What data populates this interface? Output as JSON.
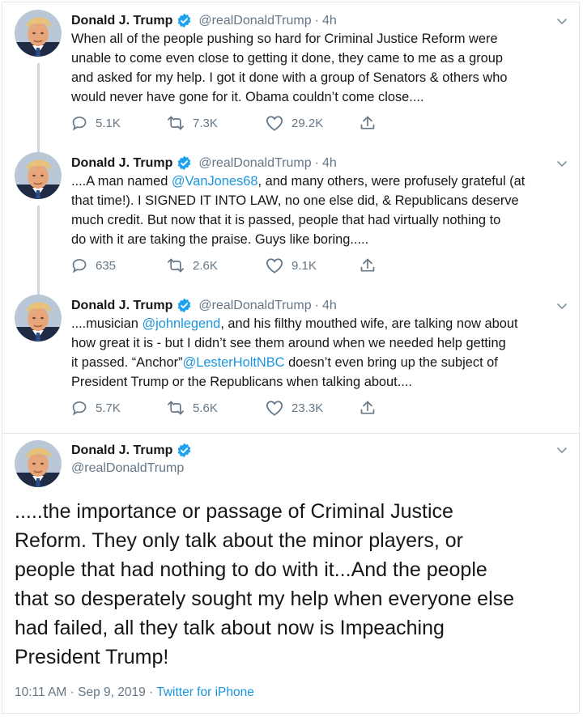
{
  "tweets": [
    {
      "name": "Donald J. Trump",
      "handle": "@realDonaldTrump",
      "time": "4h",
      "lines": [
        [
          {
            "t": "When all of the people pushing so hard for Criminal Justice Reform were"
          }
        ],
        [
          {
            "t": "unable to come even close to getting it done, they came to me as a group"
          }
        ],
        [
          {
            "t": "and asked for my help. I got it done with a group of Senators & others who"
          }
        ],
        [
          {
            "t": "would never have gone for it. Obama couldn’t come close...."
          }
        ]
      ],
      "replies": "5.1K",
      "retweets": "7.3K",
      "likes": "29.2K"
    },
    {
      "name": "Donald J. Trump",
      "handle": "@realDonaldTrump",
      "time": "4h",
      "lines": [
        [
          {
            "t": "....A man named "
          },
          {
            "t": "@VanJones68",
            "m": true
          },
          {
            "t": ", and many others, were profusely grateful (at"
          }
        ],
        [
          {
            "t": "that time!). I SIGNED IT INTO LAW, no one else did, & Republicans deserve"
          }
        ],
        [
          {
            "t": "much credit. But now that it is passed, people that had virtually nothing to"
          }
        ],
        [
          {
            "t": "do with it are taking the praise. Guys like boring....."
          }
        ]
      ],
      "replies": "635",
      "retweets": "2.6K",
      "likes": "9.1K"
    },
    {
      "name": "Donald J. Trump",
      "handle": "@realDonaldTrump",
      "time": "4h",
      "lines": [
        [
          {
            "t": "....musician "
          },
          {
            "t": "@johnlegend",
            "m": true
          },
          {
            "t": ", and his filthy mouthed wife, are talking now about"
          }
        ],
        [
          {
            "t": "how great it is - but I didn’t see them around when we needed help getting"
          }
        ],
        [
          {
            "t": "it passed. “Anchor”"
          },
          {
            "t": "@LesterHoltNBC",
            "m": true
          },
          {
            "t": " doesn’t even bring up the subject of"
          }
        ],
        [
          {
            "t": "President Trump or the Republicans when talking about...."
          }
        ]
      ],
      "replies": "5.7K",
      "retweets": "5.6K",
      "likes": "23.3K"
    }
  ],
  "main_tweet": {
    "name": "Donald J. Trump",
    "handle": "@realDonaldTrump",
    "lines": [
      ".....the importance or passage of Criminal Justice",
      "Reform. They only talk about the minor players, or",
      "people that had nothing to do with it...And the people",
      "that so desperately sought my help when everyone else",
      "had failed, all they talk about now is Impeaching",
      "President Trump!"
    ],
    "timestamp": "10:11 AM · Sep 9, 2019 ·",
    "source": "Twitter for iPhone"
  },
  "icons": {
    "reply": "reply-icon",
    "retweet": "retweet-icon",
    "like": "heart-icon",
    "share": "share-icon",
    "verified": "verified-badge-icon",
    "caret": "chevron-down-icon"
  },
  "colors": {
    "accent": "#1b95e0",
    "verified": "#1da1f2",
    "secondary_text": "#657786",
    "thread_line": "#ccd6dd"
  }
}
